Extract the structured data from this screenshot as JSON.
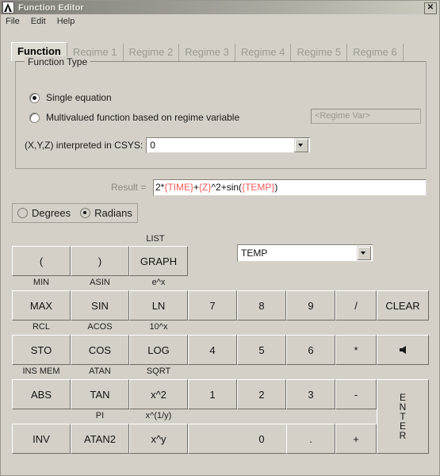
{
  "window": {
    "title": "Function Editor",
    "close_label": "✕",
    "icon": "peak-app-icon"
  },
  "menu": {
    "items": [
      {
        "label": "File"
      },
      {
        "label": "Edit"
      },
      {
        "label": "Help"
      }
    ]
  },
  "tabs": {
    "active_index": 0,
    "items": [
      {
        "label": "Function",
        "enabled": true
      },
      {
        "label": "Regime 1",
        "enabled": false
      },
      {
        "label": "Regime 2",
        "enabled": false
      },
      {
        "label": "Regime 3",
        "enabled": false
      },
      {
        "label": "Regime 4",
        "enabled": false
      },
      {
        "label": "Regime 5",
        "enabled": false
      },
      {
        "label": "Regime 6",
        "enabled": false
      }
    ]
  },
  "function_type": {
    "legend": "Function Type",
    "single_equation_label": "Single equation",
    "single_equation_selected": true,
    "multivalued_label": "Multivalued function based on regime variable",
    "multivalued_selected": false,
    "regime_var_placeholder": "<Regime Var>",
    "csys_label": "(X,Y,Z) interpreted in CSYS:",
    "csys_value": "0"
  },
  "result": {
    "label": "Result =",
    "expression": "2*{TIME}+{Z}^2+sin({TEMP})",
    "tokens": [
      {
        "text": "2*",
        "color": "black"
      },
      {
        "text": "{TIME}",
        "color": "red"
      },
      {
        "text": "+",
        "color": "black"
      },
      {
        "text": "{Z}",
        "color": "red"
      },
      {
        "text": "^2+sin(",
        "color": "black"
      },
      {
        "text": "{TEMP}",
        "color": "red"
      },
      {
        "text": ")",
        "color": "black"
      }
    ],
    "variable_color": "#ef5a5a"
  },
  "angle_mode": {
    "degrees_label": "Degrees",
    "radians_label": "Radians",
    "selected": "Radians"
  },
  "variable_select": {
    "value": "TEMP"
  },
  "keypad": {
    "shift_labels": {
      "list": "LIST",
      "min": "MIN",
      "asin": "ASIN",
      "expx": "e^x",
      "rcl": "RCL",
      "acos": "ACOS",
      "ten_x": "10^x",
      "ins_mem": "INS MEM",
      "atan": "ATAN",
      "sqrt": "SQRT",
      "pi": "PI",
      "x_root_y": "x^(1/y)"
    },
    "buttons": {
      "lparen": "(",
      "rparen": ")",
      "graph": "GRAPH",
      "max": "MAX",
      "sin": "SIN",
      "ln": "LN",
      "sto": "STO",
      "cos": "COS",
      "log": "LOG",
      "abs": "ABS",
      "tan": "TAN",
      "x2": "x^2",
      "inv": "INV",
      "atan2": "ATAN2",
      "xy": "x^y",
      "n7": "7",
      "n8": "8",
      "n9": "9",
      "divide": "/",
      "clear": "CLEAR",
      "n4": "4",
      "n5": "5",
      "n6": "6",
      "multiply": "*",
      "backspace": "backspace-arrow-icon",
      "n1": "1",
      "n2": "2",
      "n3": "3",
      "minus": "-",
      "n0": "0",
      "dot": ".",
      "plus": "+",
      "enter_letters": [
        "E",
        "N",
        "T",
        "E",
        "R"
      ]
    }
  },
  "colors": {
    "window_background": "#d4d0c8",
    "field_background": "#ffffff",
    "variable_red": "#ef5a5a",
    "disabled_text": "#9d9a92"
  }
}
